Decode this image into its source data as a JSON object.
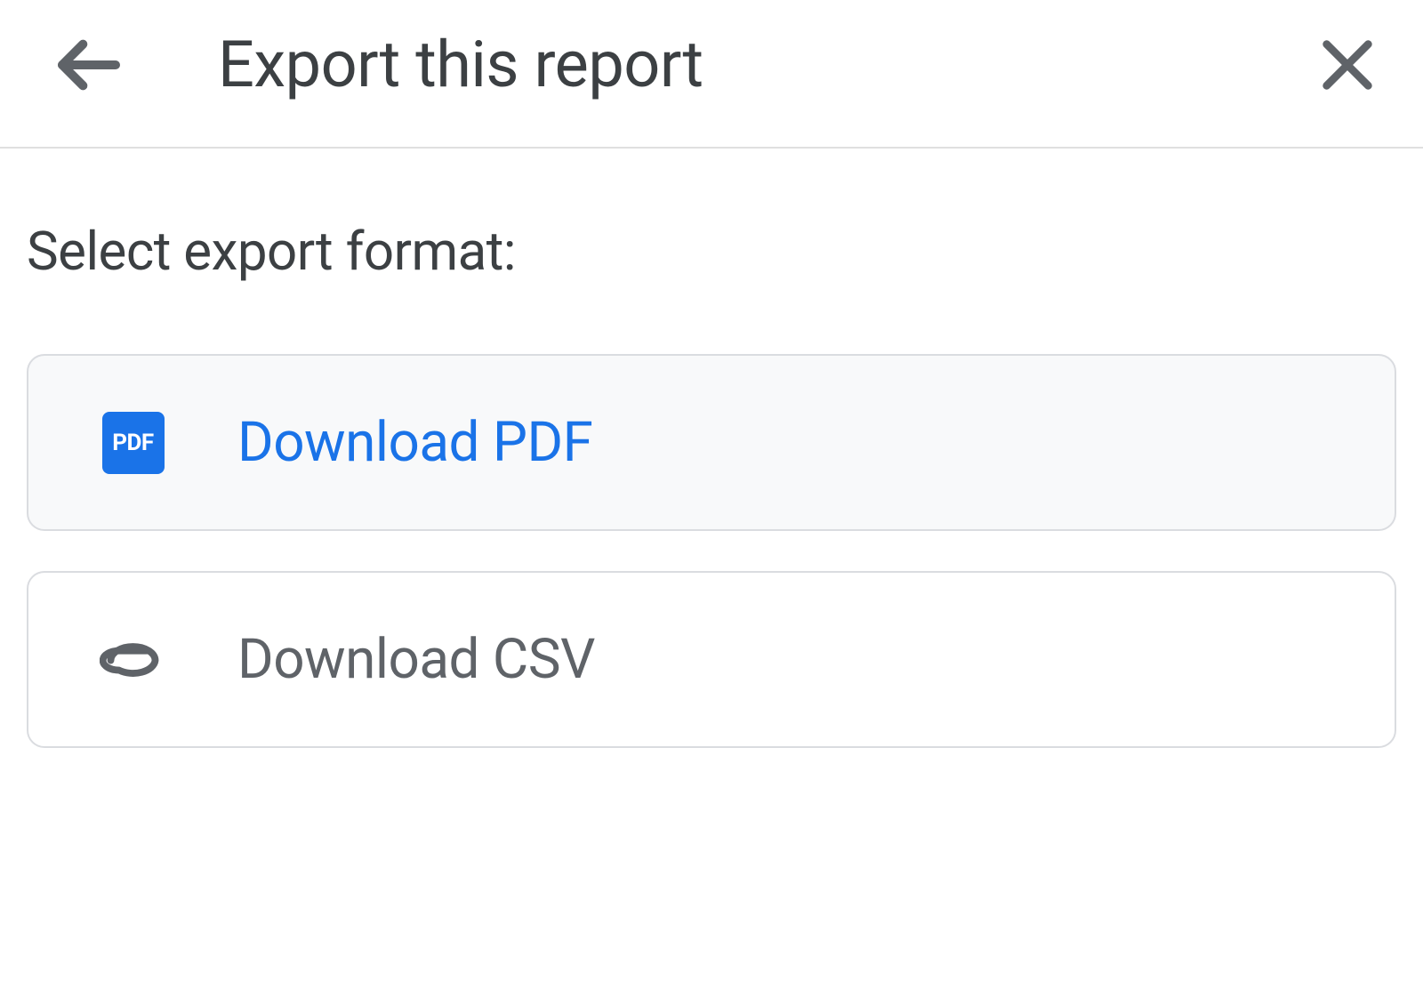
{
  "header": {
    "title": "Export this report"
  },
  "content": {
    "prompt": "Select export format:",
    "options": [
      {
        "icon_name": "pdf-icon",
        "icon_text": "PDF",
        "label": "Download PDF",
        "selected": true
      },
      {
        "icon_name": "attachment-icon",
        "label": "Download CSV",
        "selected": false
      }
    ]
  },
  "colors": {
    "accent": "#1a73e8",
    "text_primary": "#3c4043",
    "text_secondary": "#5f6368",
    "border": "#dadce0",
    "selected_bg": "#f8f9fa"
  }
}
